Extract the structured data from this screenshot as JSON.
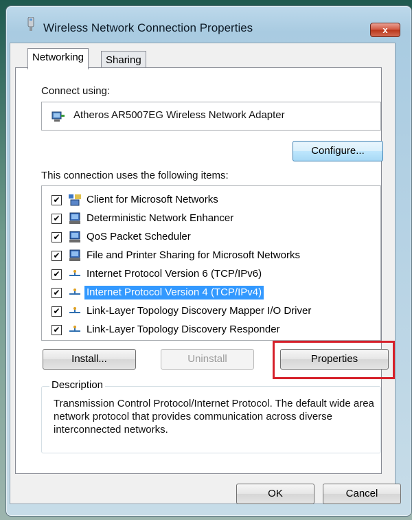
{
  "window": {
    "title": "Wireless Network Connection Properties",
    "close_label": "x"
  },
  "tabs": [
    {
      "label": "Networking",
      "active": true
    },
    {
      "label": "Sharing",
      "active": false
    }
  ],
  "connect_using": {
    "label": "Connect using:",
    "adapter_name": "Atheros AR5007EG Wireless Network Adapter",
    "adapter_icon": "network-adapter-icon",
    "configure_label": "Configure..."
  },
  "items_section": {
    "label": "This connection uses the following items:",
    "items": [
      {
        "label": "Client for Microsoft Networks",
        "checked": true,
        "icon": "network-client-icon",
        "selected": false
      },
      {
        "label": "Deterministic Network Enhancer",
        "checked": true,
        "icon": "network-service-icon",
        "selected": false
      },
      {
        "label": "QoS Packet Scheduler",
        "checked": true,
        "icon": "network-service-icon",
        "selected": false
      },
      {
        "label": "File and Printer Sharing for Microsoft Networks",
        "checked": true,
        "icon": "network-service-icon",
        "selected": false
      },
      {
        "label": "Internet Protocol Version 6 (TCP/IPv6)",
        "checked": true,
        "icon": "protocol-icon",
        "selected": false
      },
      {
        "label": "Internet Protocol Version 4 (TCP/IPv4)",
        "checked": true,
        "icon": "protocol-icon",
        "selected": true
      },
      {
        "label": "Link-Layer Topology Discovery Mapper I/O Driver",
        "checked": true,
        "icon": "protocol-icon",
        "selected": false
      },
      {
        "label": "Link-Layer Topology Discovery Responder",
        "checked": true,
        "icon": "protocol-icon",
        "selected": false
      }
    ]
  },
  "buttons": {
    "install": "Install...",
    "uninstall": "Uninstall",
    "properties": "Properties",
    "ok": "OK",
    "cancel": "Cancel"
  },
  "description": {
    "legend": "Description",
    "text": "Transmission Control Protocol/Internet Protocol. The default wide area network protocol that provides communication across diverse interconnected networks."
  },
  "colors": {
    "selection": "#3399ff",
    "highlight_box": "#d6202a"
  }
}
